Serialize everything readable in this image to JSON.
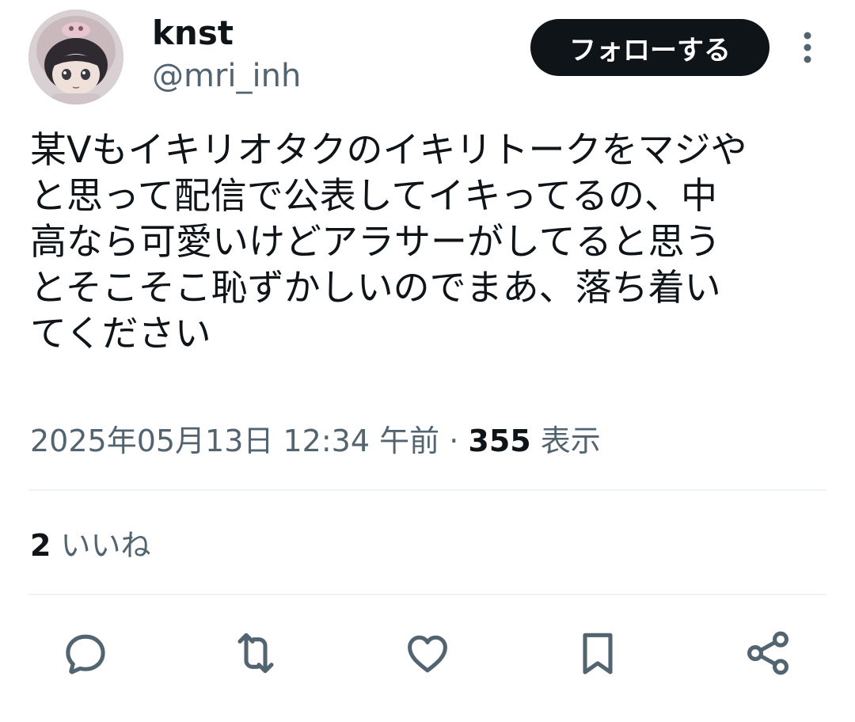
{
  "author": {
    "display_name": "knst",
    "handle": "@mri_inh"
  },
  "follow_button_label": "フォローする",
  "tweet": {
    "text": "某Vもイキリオタクのイキリトークをマジや\nと思って配信で公表してイキってるの、中\n高なら可愛いけどアラサーがしてると思う\nとそこそこ恥ずかしいのでまあ、落ち着い\nてください",
    "timestamp": "2025年05月13日 12:34 午前",
    "separator": "·",
    "views_count": "355",
    "views_label": "表示"
  },
  "engagement": {
    "likes_count": "2",
    "likes_label": "いいね"
  },
  "actions": [
    {
      "icon": "reply-icon"
    },
    {
      "icon": "retweet-icon"
    },
    {
      "icon": "like-icon"
    },
    {
      "icon": "bookmark-icon"
    },
    {
      "icon": "share-icon"
    }
  ],
  "colors": {
    "text_primary": "#0f1419",
    "text_secondary": "#536471",
    "divider": "#eff3f4",
    "follow_bg": "#0f1419",
    "icon": "#536471"
  }
}
